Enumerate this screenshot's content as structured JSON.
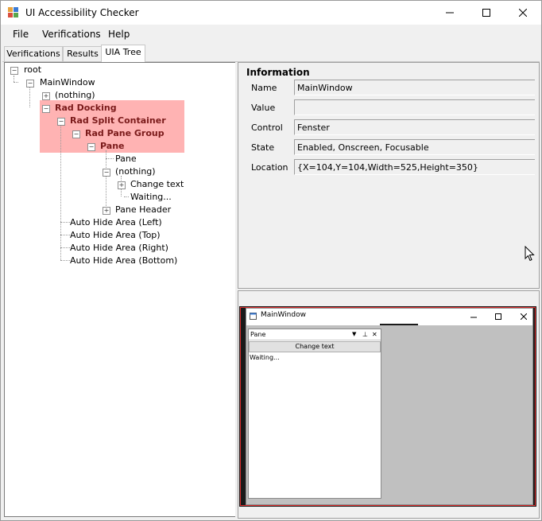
{
  "window": {
    "title": "UI Accessibility Checker",
    "controls": [
      "minimize",
      "maximize",
      "close"
    ]
  },
  "menu": [
    {
      "label": "File"
    },
    {
      "label": "Verifications"
    },
    {
      "label": "Help"
    }
  ],
  "tabs": [
    {
      "label": "Verifications",
      "active": false
    },
    {
      "label": "Results",
      "active": false
    },
    {
      "label": "UIA Tree",
      "active": true
    }
  ],
  "tree": {
    "root": "root",
    "main_window": "MainWindow",
    "nothing_1": "(nothing)",
    "rad_docking": "Rad Docking",
    "rad_split_container": "Rad Split Container",
    "rad_pane_group": "Rad Pane Group",
    "pane_selected": "Pane",
    "pane": "Pane",
    "nothing_2": "(nothing)",
    "change_text": "Change text",
    "waiting": "Waiting...",
    "pane_header": "Pane Header",
    "auto_hide_left": "Auto Hide Area (Left)",
    "auto_hide_top": "Auto Hide Area (Top)",
    "auto_hide_right": "Auto Hide Area (Right)",
    "auto_hide_bottom": "Auto Hide Area (Bottom)"
  },
  "information": {
    "title": "Information",
    "properties": [
      {
        "label": "Name",
        "value": "MainWindow"
      },
      {
        "label": "Value",
        "value": ""
      },
      {
        "label": "Control",
        "value": "Fenster"
      },
      {
        "label": "State",
        "value": "Enabled, Onscreen, Focusable"
      },
      {
        "label": "Location",
        "value": "{X=104,Y=104,Width=525,Height=350}"
      }
    ]
  },
  "preview": {
    "window_title": "MainWindow",
    "pane_header": "Pane",
    "button_label": "Change text",
    "status_text": "Waiting..."
  },
  "colors": {
    "selection_highlight": "#ffb3b3",
    "selected_text": "#7a1a1a",
    "preview_outline": "#e03030"
  }
}
